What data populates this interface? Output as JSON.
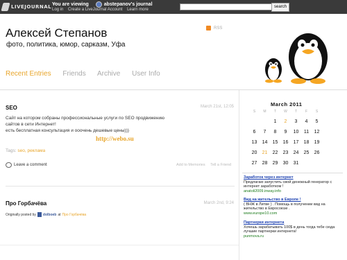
{
  "topbar": {
    "logo_text": "LIVEJOURNAL",
    "logo_sup": "™",
    "viewing_label": "You are viewing",
    "viewing_user": "abstepanov's journal",
    "links": [
      "Log in",
      "Create a LiveJournal Account",
      "Learn more"
    ],
    "search_value": "",
    "search_button": "search"
  },
  "header": {
    "title": "Алексей Степанов",
    "subtitle": "фото, политика, юмор, сарказм, Уфа",
    "rss": "RSS"
  },
  "nav": [
    "Recent Entries",
    "Friends",
    "Archive",
    "User Info"
  ],
  "posts": [
    {
      "title": "SEO",
      "date": "March 21st, 12:05",
      "body_lines": [
        "Сайт на котором собраны профессиональные услуги по SEO продвижению",
        "сайтов в сети Интернет!",
        "есть бесплатная консультация и ооочень дешевые цены)))"
      ],
      "link": "http://webo.su",
      "tags_label": "Tags:",
      "tags": "seo, реклама",
      "comment": "Leave a comment",
      "actions": [
        "Add to Memories",
        "Tell a Friend"
      ]
    },
    {
      "title": "Про Горбачёва",
      "date": "March 2nd, 9:24",
      "orig_prefix": "Originally posted by",
      "orig_user": "dolboeb",
      "orig_suffix": "at",
      "orig_link": "Про Горбачёва"
    }
  ],
  "calendar": {
    "title": "March 2011",
    "dow": [
      "S",
      "M",
      "T",
      "W",
      "T",
      "F",
      "S"
    ],
    "weeks": [
      [
        "",
        "",
        "1",
        "2",
        "3",
        "4",
        "5"
      ],
      [
        "6",
        "7",
        "8",
        "9",
        "10",
        "11",
        "12"
      ],
      [
        "13",
        "14",
        "15",
        "16",
        "17",
        "18",
        "19"
      ],
      [
        "20",
        "21",
        "22",
        "23",
        "24",
        "25",
        "26"
      ],
      [
        "27",
        "28",
        "29",
        "30",
        "31",
        "",
        ""
      ]
    ],
    "highlighted": [
      "2",
      "21"
    ]
  },
  "ads": [
    {
      "headline": "Заработок через интернет",
      "desc": [
        "Предлагаю запустить свой денежный генератор с",
        "интернет заработком !"
      ],
      "url": "anatoli2009.inway.info"
    },
    {
      "headline": "Вид на жительство в Европе !",
      "desc": [
        "( ВНЖ в Литве ) . Помощь в получении вид на",
        "жительство в Евросоюзе ."
      ],
      "url": "www.europe10.com"
    },
    {
      "headline": "Партнерки интернета",
      "desc": [
        "Хочешь зарабатывать 100$ в день тогда тебе сюда",
        "лучшие партнерки интернета!"
      ],
      "url": "punmova.ru"
    }
  ],
  "colors": {
    "accent": "#e8a52a",
    "topbar": "#3a3a3a",
    "ad_link": "#1a3fb0",
    "ad_url": "#1a7a1a"
  }
}
